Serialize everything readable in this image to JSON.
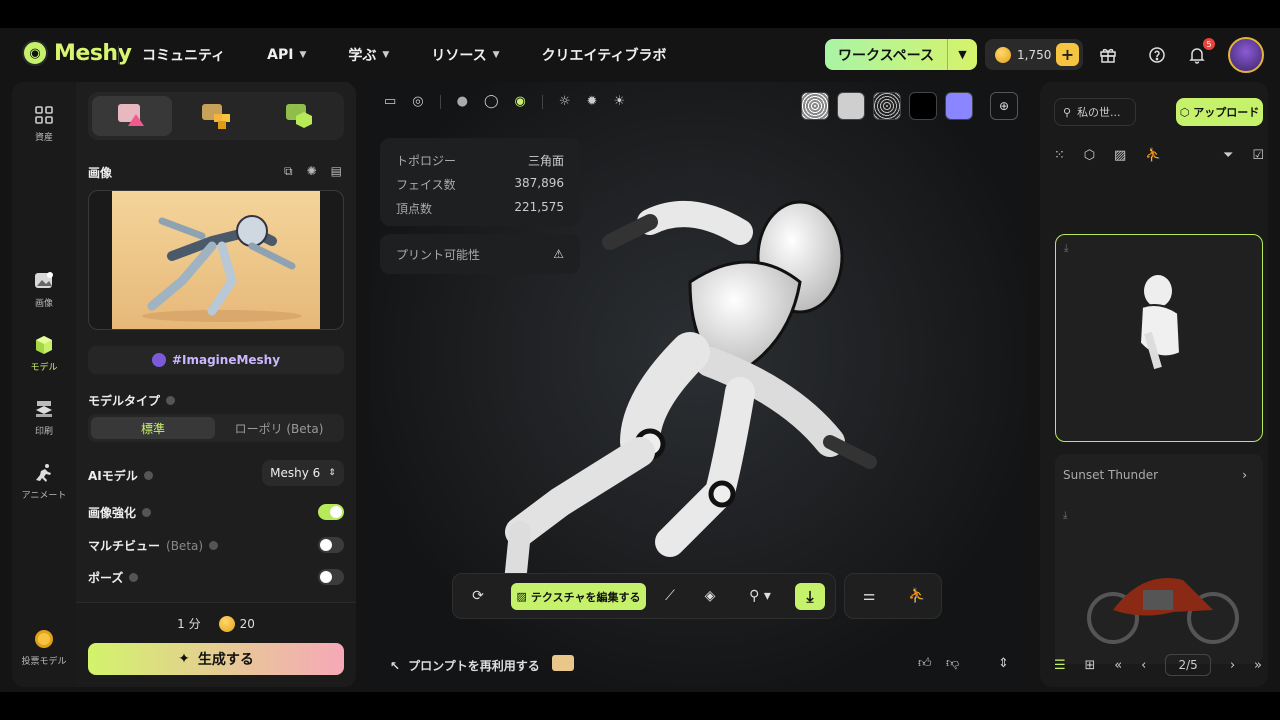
{
  "brand": {
    "name": "Meshy"
  },
  "nav": [
    {
      "label": "コミュニティ",
      "caret": false
    },
    {
      "label": "API",
      "caret": true
    },
    {
      "label": "学ぶ",
      "caret": true
    },
    {
      "label": "リソース",
      "caret": true
    },
    {
      "label": "クリエイティブラボ",
      "caret": false
    }
  ],
  "header": {
    "workspace_label": "ワークスペース",
    "credits": "1,750",
    "notifications_count": "5"
  },
  "rail": [
    {
      "label": "資産",
      "icon": "grid-icon"
    },
    {
      "label": "画像",
      "icon": "image-icon"
    },
    {
      "label": "モデル",
      "icon": "cube-icon",
      "active": true
    },
    {
      "label": "印刷",
      "icon": "printer-icon"
    },
    {
      "label": "アニメート",
      "icon": "running-icon"
    },
    {
      "label": "投票モデル",
      "icon": "vote-icon"
    }
  ],
  "left": {
    "image_title": "画像",
    "hashtag": "#ImagineMeshy",
    "model_type_label": "モデルタイプ",
    "model_type_options": [
      "標準",
      "ローポリ (Beta)"
    ],
    "ai_model_label": "AIモデル",
    "ai_model_value": "Meshy 6",
    "enhance_label": "画像強化",
    "multiview_label": "マルチビュー",
    "multiview_suffix": "(Beta)",
    "pose_label": "ポーズ",
    "time": "1 分",
    "cost": "20",
    "generate_label": "生成する"
  },
  "viewer": {
    "stats": [
      {
        "k": "トポロジー",
        "v": "三角面"
      },
      {
        "k": "フェイス数",
        "v": "387,896"
      },
      {
        "k": "頂点数",
        "v": "221,575"
      }
    ],
    "printability_label": "プリント可能性",
    "edit_texture_label": "テクスチャを編集する",
    "reuse_prompt_label": "プロンプトを再利用する"
  },
  "right": {
    "search_placeholder": "私の世...",
    "upload_label": "アップロード",
    "card2_title": "Sunset Thunder",
    "page": "2/5"
  },
  "colors": {
    "accent": "#c6f26b",
    "panel": "#1e1e1e",
    "background": "#141414"
  }
}
